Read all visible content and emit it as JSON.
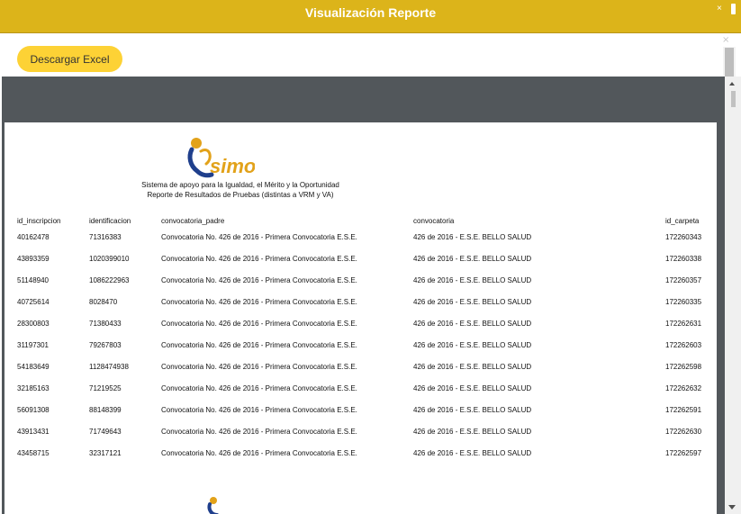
{
  "window": {
    "title": "Visualización Reporte",
    "close_glyph": "×"
  },
  "dialog": {
    "close_glyph": "×"
  },
  "toolbar": {
    "download_excel_label": "Descargar Excel"
  },
  "report": {
    "logo_text": "simo",
    "caption_line1": "Sistema de apoyo para la Igualdad, el Mérito y la Oportunidad",
    "caption_line2": "Reporte de Resultados de Pruebas (distintas a VRM y VA)",
    "columns": [
      "id_inscripcion",
      "identificacion",
      "convocatoria_padre",
      "convocatoria",
      "id_carpeta"
    ],
    "rows": [
      [
        "40162478",
        "71316383",
        "Convocatoria No. 426 de 2016 - Primera Convocatoria E.S.E.",
        "426 de 2016 - E.S.E. BELLO SALUD",
        "172260343"
      ],
      [
        "43893359",
        "1020399010",
        "Convocatoria No. 426 de 2016 - Primera Convocatoria E.S.E.",
        "426 de 2016 - E.S.E. BELLO SALUD",
        "172260338"
      ],
      [
        "51148940",
        "1086222963",
        "Convocatoria No. 426 de 2016 - Primera Convocatoria E.S.E.",
        "426 de 2016 - E.S.E. BELLO SALUD",
        "172260357"
      ],
      [
        "40725614",
        "8028470",
        "Convocatoria No. 426 de 2016 - Primera Convocatoria E.S.E.",
        "426 de 2016 - E.S.E. BELLO SALUD",
        "172260335"
      ],
      [
        "28300803",
        "71380433",
        "Convocatoria No. 426 de 2016 - Primera Convocatoria E.S.E.",
        "426 de 2016 - E.S.E. BELLO SALUD",
        "172262631"
      ],
      [
        "31197301",
        "79267803",
        "Convocatoria No. 426 de 2016 - Primera Convocatoria E.S.E.",
        "426 de 2016 - E.S.E. BELLO SALUD",
        "172262603"
      ],
      [
        "54183649",
        "1128474938",
        "Convocatoria No. 426 de 2016 - Primera Convocatoria E.S.E.",
        "426 de 2016 - E.S.E. BELLO SALUD",
        "172262598"
      ],
      [
        "32185163",
        "71219525",
        "Convocatoria No. 426 de 2016 - Primera Convocatoria E.S.E.",
        "426 de 2016 - E.S.E. BELLO SALUD",
        "172262632"
      ],
      [
        "56091308",
        "88148399",
        "Convocatoria No. 426 de 2016 - Primera Convocatoria E.S.E.",
        "426 de 2016 - E.S.E. BELLO SALUD",
        "172262591"
      ],
      [
        "43913431",
        "71749643",
        "Convocatoria No. 426 de 2016 - Primera Convocatoria E.S.E.",
        "426 de 2016 - E.S.E. BELLO SALUD",
        "172262630"
      ],
      [
        "43458715",
        "32317121",
        "Convocatoria No. 426 de 2016 - Primera Convocatoria E.S.E.",
        "426 de 2016 - E.S.E. BELLO SALUD",
        "172262597"
      ]
    ]
  },
  "colors": {
    "title_bar": "#dcb41a",
    "button": "#fdd235",
    "viewer_background": "#52575b",
    "logo_gold": "#e2a21a",
    "logo_blue": "#1f3f8c"
  }
}
